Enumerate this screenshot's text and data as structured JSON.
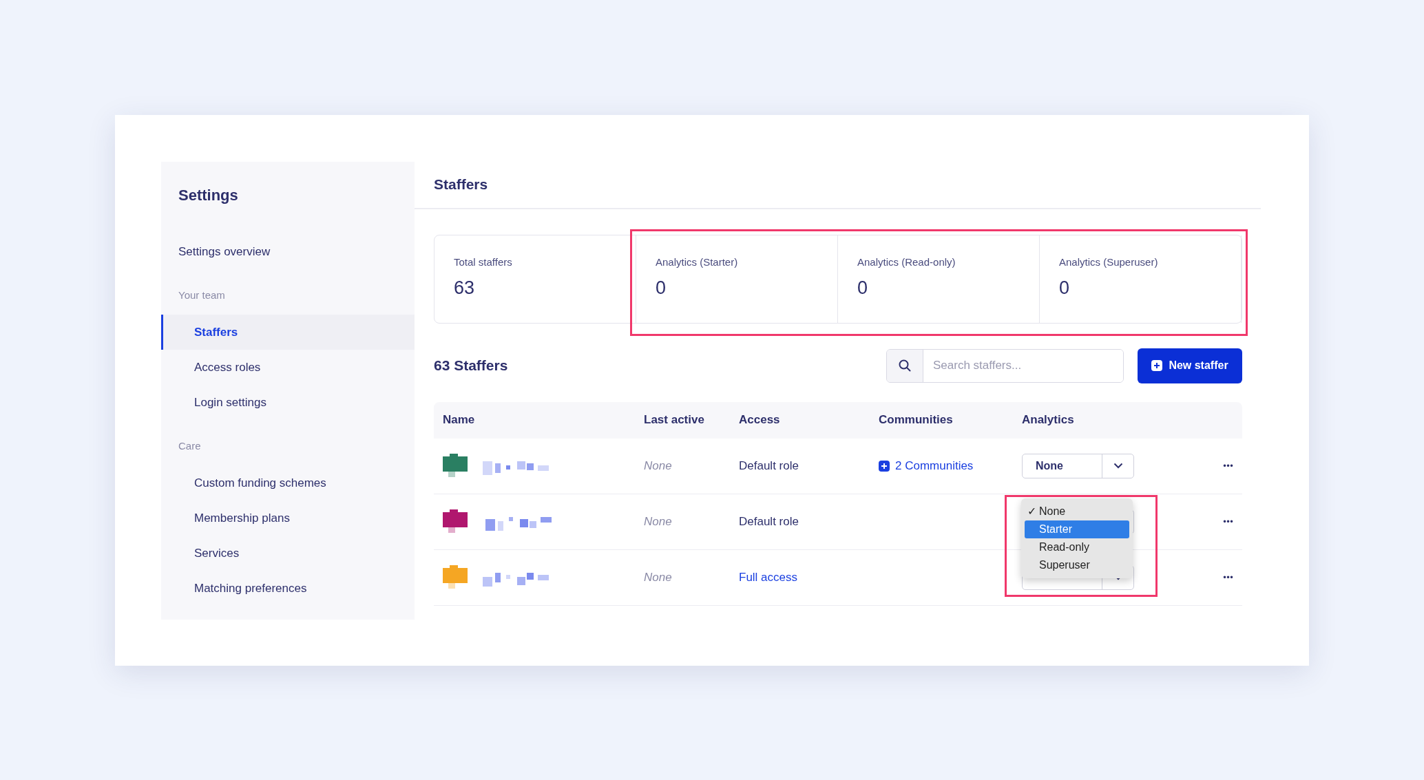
{
  "sidebar": {
    "title": "Settings",
    "items": [
      {
        "kind": "link",
        "label": "Settings overview",
        "selected": false
      },
      {
        "kind": "heading",
        "label": "Your team"
      },
      {
        "kind": "subitem",
        "label": "Staffers",
        "selected": true
      },
      {
        "kind": "subitem",
        "label": "Access roles",
        "selected": false
      },
      {
        "kind": "subitem",
        "label": "Login settings",
        "selected": false
      },
      {
        "kind": "heading",
        "label": "Care"
      },
      {
        "kind": "subitem",
        "label": "Custom funding schemes",
        "selected": false
      },
      {
        "kind": "subitem",
        "label": "Membership plans",
        "selected": false
      },
      {
        "kind": "subitem",
        "label": "Services",
        "selected": false
      },
      {
        "kind": "subitem",
        "label": "Matching preferences",
        "selected": false
      }
    ]
  },
  "header": {
    "title": "Staffers"
  },
  "stats": [
    {
      "label": "Total staffers",
      "value": "63",
      "highlighted": false
    },
    {
      "label": "Analytics (Starter)",
      "value": "0",
      "highlighted": true
    },
    {
      "label": "Analytics (Read-only)",
      "value": "0",
      "highlighted": true
    },
    {
      "label": "Analytics (Superuser)",
      "value": "0",
      "highlighted": true
    }
  ],
  "list": {
    "title": "63 Staffers",
    "search": {
      "placeholder": "Search staffers..."
    },
    "new_button": "New staffer"
  },
  "table": {
    "columns": [
      "Name",
      "Last active",
      "Access",
      "Communities",
      "Analytics"
    ],
    "rows": [
      {
        "color": "#2a7f62",
        "last_active": "None",
        "access": {
          "text": "Default role",
          "kind": "text"
        },
        "communities": "2 Communities",
        "analytics": "None",
        "more": "•••"
      },
      {
        "color": "#b0176e",
        "last_active": "None",
        "access": {
          "text": "Default role",
          "kind": "text"
        },
        "more": "•••",
        "analytics_menu": {
          "highlighted": true,
          "check_mark": "✓",
          "options": [
            {
              "label": "None",
              "checked": true,
              "selected": false
            },
            {
              "label": "Starter",
              "checked": false,
              "selected": true
            },
            {
              "label": "Read-only",
              "checked": false,
              "selected": false
            },
            {
              "label": "Superuser",
              "checked": false,
              "selected": false
            }
          ]
        }
      },
      {
        "color": "#f5a623",
        "last_active": "None",
        "access": {
          "text": "Full access",
          "kind": "link"
        },
        "more": "•••"
      }
    ]
  }
}
